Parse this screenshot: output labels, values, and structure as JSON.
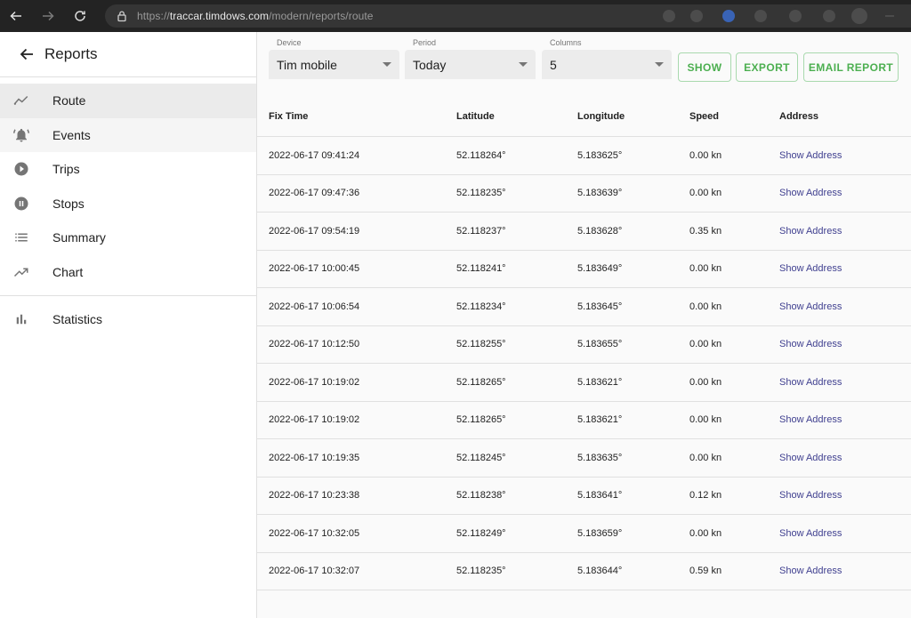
{
  "browser": {
    "url_prefix": "https://",
    "url_host": "traccar.timdows.com",
    "url_path": "/modern/reports/route"
  },
  "sidebar": {
    "title": "Reports",
    "items": [
      {
        "label": "Route",
        "icon": "route-icon"
      },
      {
        "label": "Events",
        "icon": "bell-icon"
      },
      {
        "label": "Trips",
        "icon": "play-circle-icon"
      },
      {
        "label": "Stops",
        "icon": "pause-circle-icon"
      },
      {
        "label": "Summary",
        "icon": "list-icon"
      },
      {
        "label": "Chart",
        "icon": "trending-up-icon"
      }
    ],
    "statistics_label": "Statistics"
  },
  "filters": {
    "device_label": "Device",
    "device_value": "Tim mobile",
    "period_label": "Period",
    "period_value": "Today",
    "columns_label": "Columns",
    "columns_value": "5",
    "show_label": "SHOW",
    "export_label": "EXPORT",
    "email_label": "EMAIL REPORT"
  },
  "table": {
    "headers": [
      "Fix Time",
      "Latitude",
      "Longitude",
      "Speed",
      "Address"
    ],
    "rows": [
      {
        "time": "2022-06-17 09:41:24",
        "lat": "52.118264°",
        "lon": "5.183625°",
        "speed": "0.00 kn",
        "address": "Show Address"
      },
      {
        "time": "2022-06-17 09:47:36",
        "lat": "52.118235°",
        "lon": "5.183639°",
        "speed": "0.00 kn",
        "address": "Show Address"
      },
      {
        "time": "2022-06-17 09:54:19",
        "lat": "52.118237°",
        "lon": "5.183628°",
        "speed": "0.35 kn",
        "address": "Show Address"
      },
      {
        "time": "2022-06-17 10:00:45",
        "lat": "52.118241°",
        "lon": "5.183649°",
        "speed": "0.00 kn",
        "address": "Show Address"
      },
      {
        "time": "2022-06-17 10:06:54",
        "lat": "52.118234°",
        "lon": "5.183645°",
        "speed": "0.00 kn",
        "address": "Show Address"
      },
      {
        "time": "2022-06-17 10:12:50",
        "lat": "52.118255°",
        "lon": "5.183655°",
        "speed": "0.00 kn",
        "address": "Show Address"
      },
      {
        "time": "2022-06-17 10:19:02",
        "lat": "52.118265°",
        "lon": "5.183621°",
        "speed": "0.00 kn",
        "address": "Show Address"
      },
      {
        "time": "2022-06-17 10:19:02",
        "lat": "52.118265°",
        "lon": "5.183621°",
        "speed": "0.00 kn",
        "address": "Show Address"
      },
      {
        "time": "2022-06-17 10:19:35",
        "lat": "52.118245°",
        "lon": "5.183635°",
        "speed": "0.00 kn",
        "address": "Show Address"
      },
      {
        "time": "2022-06-17 10:23:38",
        "lat": "52.118238°",
        "lon": "5.183641°",
        "speed": "0.12 kn",
        "address": "Show Address"
      },
      {
        "time": "2022-06-17 10:32:05",
        "lat": "52.118249°",
        "lon": "5.183659°",
        "speed": "0.00 kn",
        "address": "Show Address"
      },
      {
        "time": "2022-06-17 10:32:07",
        "lat": "52.118235°",
        "lon": "5.183644°",
        "speed": "0.59 kn",
        "address": "Show Address"
      }
    ]
  }
}
